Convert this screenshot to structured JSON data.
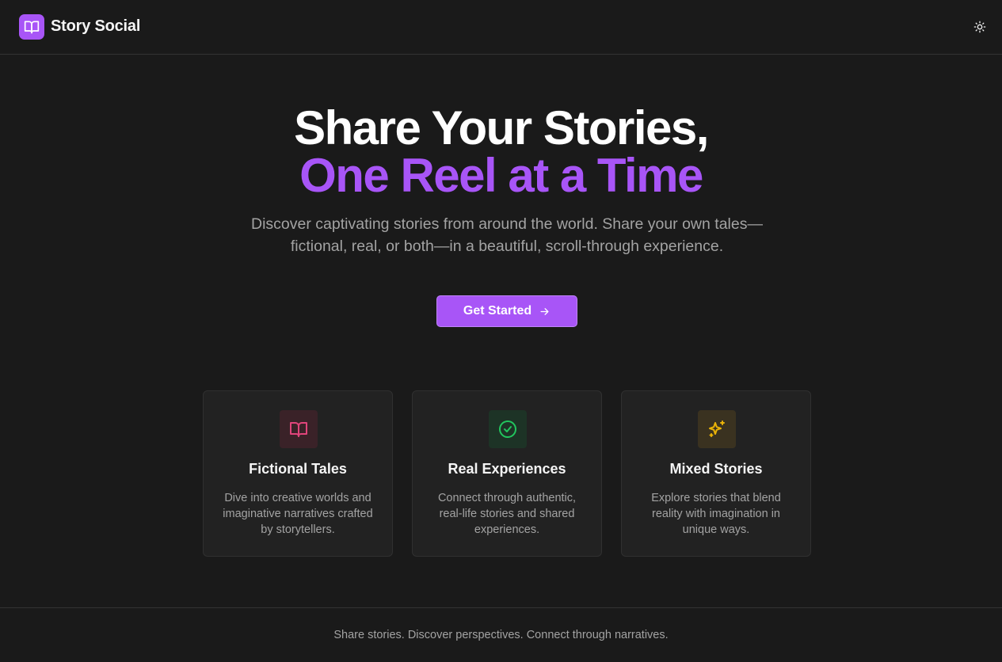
{
  "header": {
    "brand": "Story Social",
    "logo_icon": "book-open-icon",
    "theme_icon": "sun-icon"
  },
  "hero": {
    "title_line1": "Share Your Stories,",
    "title_line2": "One Reel at a Time",
    "subtitle": "Discover captivating stories from around the world. Share your own tales—fictional, real, or both—in a beautiful, scroll-through experience.",
    "cta_label": "Get Started",
    "cta_icon": "arrow-right-icon"
  },
  "features": [
    {
      "title": "Fictional Tales",
      "description": "Dive into creative worlds and imaginative narratives crafted by storytellers.",
      "icon": "book-open-icon",
      "icon_color": "#e0457b",
      "icon_bg": "#3a2228"
    },
    {
      "title": "Real Experiences",
      "description": "Connect through authentic, real-life stories and shared experiences.",
      "icon": "check-circle-icon",
      "icon_color": "#22c55e",
      "icon_bg": "#1d3326"
    },
    {
      "title": "Mixed Stories",
      "description": "Explore stories that blend reality with imagination in unique ways.",
      "icon": "sparkles-icon",
      "icon_color": "#eab308",
      "icon_bg": "#3a3220"
    }
  ],
  "footer": {
    "text": "Share stories. Discover perspectives. Connect through narratives."
  },
  "colors": {
    "background": "#1a1a1a",
    "accent": "#a855f7",
    "text_primary": "#f5f5f5",
    "text_muted": "#a3a3a3",
    "card_bg": "#222222",
    "border": "#333333"
  }
}
